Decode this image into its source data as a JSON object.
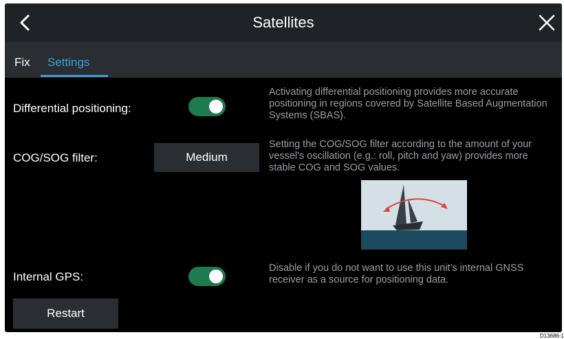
{
  "header": {
    "title": "Satellites",
    "back_icon": "chevron-left-icon",
    "close_icon": "close-icon"
  },
  "tabs": [
    {
      "label": "Fix",
      "active": false
    },
    {
      "label": "Settings",
      "active": true
    }
  ],
  "settings": {
    "differential": {
      "label": "Differential positioning:",
      "enabled": true,
      "description": "Activating differential positioning provides more accurate positioning in regions covered by Satellite Based Augmentation Systems (SBAS)."
    },
    "cog_sog": {
      "label": "COG/SOG filter:",
      "value": "Medium",
      "description": "Setting the COG/SOG filter according to the amount of your vessel's oscillation (e.g.: roll, pitch and yaw) provides more stable COG and SOG values."
    },
    "internal_gps": {
      "label": "Internal GPS:",
      "enabled": true,
      "description": "Disable if you do not want to use this unit's internal GNSS receiver as a source for positioning data."
    },
    "restart_label": "Restart"
  },
  "colors": {
    "accent": "#3aa0d6",
    "toggle_on": "#1e7a4f",
    "sky": "#d4e0e6",
    "sea": "#1d4a5e",
    "arrow": "#e0413a"
  },
  "illustration": {
    "name": "boat-oscillation-illustration"
  },
  "reference_code": "D13686-1"
}
